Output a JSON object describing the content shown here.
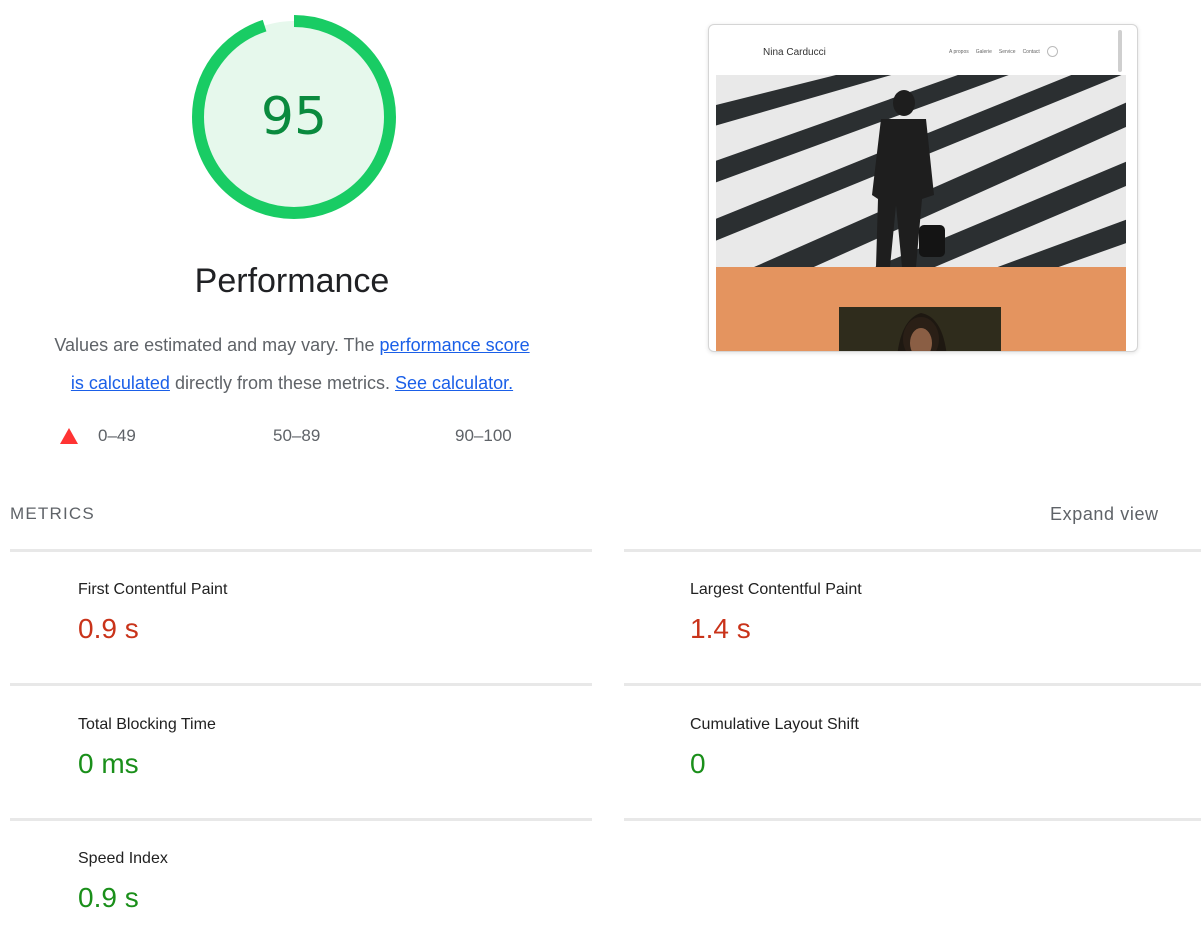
{
  "gauge": {
    "score": "95",
    "score_fraction": 0.95,
    "title": "Performance",
    "colors": {
      "arc": "#19cc64",
      "fill": "#e6f8ec",
      "text": "#0a8a3e"
    }
  },
  "description": {
    "prefix": "Values are estimated and may vary. The ",
    "link1_line1": "performance score",
    "link1_line2": "is calculated",
    "middle": " directly from these metrics. ",
    "link2": "See calculator."
  },
  "legend": [
    {
      "label": "0–49",
      "icon": "fail-triangle-icon",
      "color": "#ff3333"
    },
    {
      "label": "50–89",
      "icon": "average-square-icon",
      "color": "#ffaa33"
    },
    {
      "label": "90–100",
      "icon": "pass-circle-icon",
      "color": "#0cce6b"
    }
  ],
  "screenshot": {
    "site_name": "Nina Carducci",
    "nav": [
      "A propos",
      "Galerie",
      "Service",
      "Contact"
    ],
    "nav_icon": "instagram-icon"
  },
  "metrics": {
    "heading": "METRICS",
    "expand_label": "Expand view",
    "items": [
      {
        "label": "First Contentful Paint",
        "value": "0.9 s",
        "status": "average",
        "color": "#c9331a"
      },
      {
        "label": "Largest Contentful Paint",
        "value": "1.4 s",
        "status": "average",
        "color": "#c9331a"
      },
      {
        "label": "Total Blocking Time",
        "value": "0 ms",
        "status": "pass",
        "color": "#1a8f1a"
      },
      {
        "label": "Cumulative Layout Shift",
        "value": "0",
        "status": "pass",
        "color": "#1a8f1a"
      },
      {
        "label": "Speed Index",
        "value": "0.9 s",
        "status": "pass",
        "color": "#1a8f1a"
      }
    ]
  }
}
